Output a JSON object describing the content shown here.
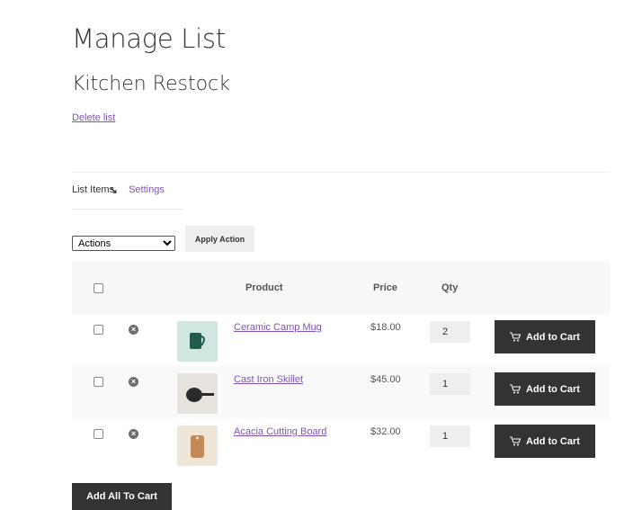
{
  "page": {
    "title": "Manage List",
    "list_name": "Kitchen Restock",
    "delete_link": "Delete list"
  },
  "tabs": [
    {
      "label": "List Items"
    },
    {
      "label": "Settings"
    }
  ],
  "bulk": {
    "select_value": "Actions",
    "apply_label": "Apply Action"
  },
  "table": {
    "headers": {
      "product": "Product",
      "price": "Price",
      "qty": "Qty"
    },
    "rows": [
      {
        "name": "Ceramic Camp Mug",
        "price": "$18.00",
        "qty": "2",
        "add_label": "Add to Cart",
        "thumb_color": "#cfe7e0"
      },
      {
        "name": "Cast Iron Skillet",
        "price": "$45.00",
        "qty": "1",
        "add_label": "Add to Cart",
        "thumb_color": "#e6e2dd"
      },
      {
        "name": "Acacia Cutting Board",
        "price": "$32.00",
        "qty": "1",
        "add_label": "Add to Cart",
        "thumb_color": "#efe6d8"
      }
    ]
  },
  "footer": {
    "add_all_label": "Add All To Cart"
  },
  "colors": {
    "accent": "#7f54b3",
    "button_dark": "#333333"
  }
}
